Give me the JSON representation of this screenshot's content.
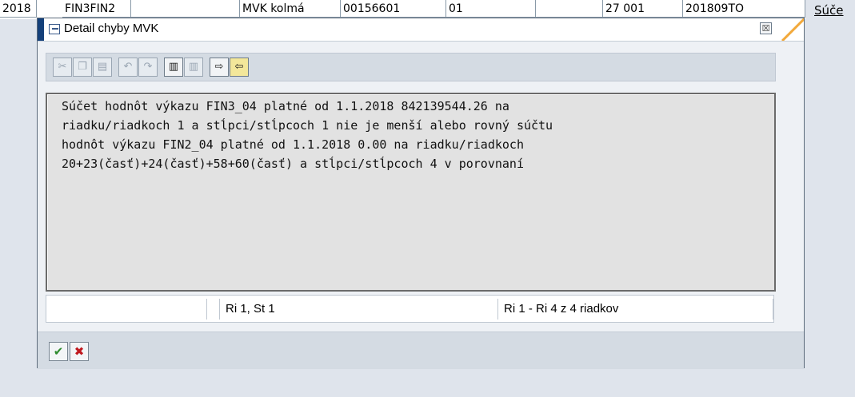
{
  "background_row": {
    "cells": [
      "2018",
      "FIN3FIN2",
      "",
      "MVK kolmá",
      "00156601",
      "01",
      "",
      "27  001",
      "201809TO"
    ],
    "right_link": "Súče"
  },
  "dialog": {
    "title": "Detail chyby MVK",
    "close_glyph": "☒",
    "text_lines": [
      "Súčet hodnôt výkazu FIN3_04 platné od 1.1.2018 842139544.26 na",
      "riadku/riadkoch 1 a stĺpci/stĺpcoch 1 nie je menší alebo rovný súčtu",
      "hodnôt výkazu FIN2_04 platné od 1.1.2018 0.00 na riadku/riadkoch",
      "20+23(časť)+24(časť)+58+60(časť) a stĺpci/stĺpcoch 4 v porovnaní"
    ],
    "status": {
      "cursor": "Ri 1, St 1",
      "range": "Ri 1 - Ri 4 z 4 riadkov"
    },
    "toolbar_icons": [
      "cut-icon",
      "copy-icon",
      "paste-icon",
      "undo-icon",
      "redo-icon",
      "find-icon",
      "find-next-icon",
      "import-icon",
      "export-icon"
    ],
    "footer": {
      "confirm_glyph": "✔",
      "cancel_glyph": "✖"
    }
  },
  "colors": {
    "accent_title_bar": "#14407a",
    "confirm": "#2e8b2e",
    "cancel": "#c0191f",
    "title_corner": "#f2a93b"
  }
}
